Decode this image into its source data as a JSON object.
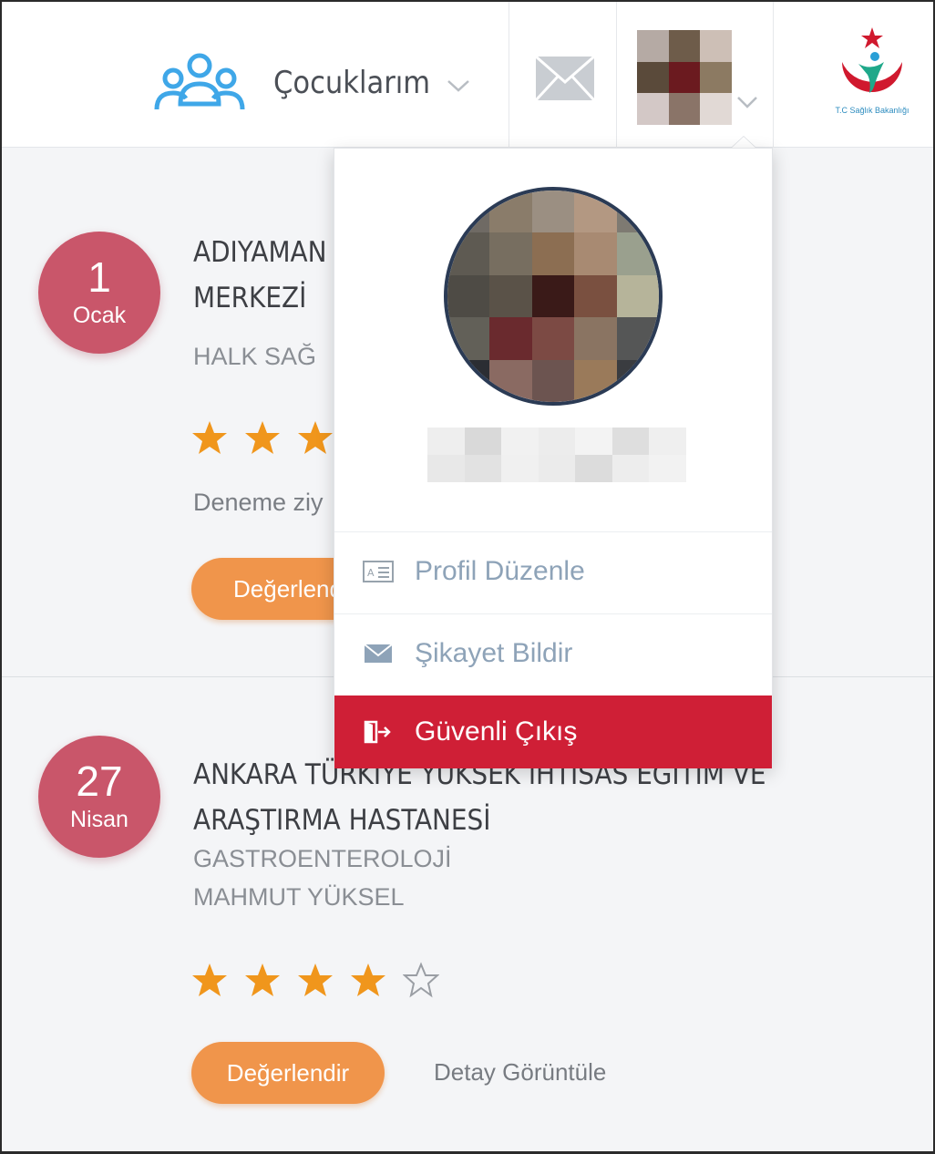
{
  "header": {
    "children_label": "Çocuklarım",
    "logo_caption": "T.C Sağlık Bakanlığı"
  },
  "appointments": [
    {
      "day": "1",
      "month": "Ocak",
      "institution_line1": "ADIYAMAN",
      "institution_line2": "MERKEZİ",
      "department": "HALK SAĞ",
      "rating": 3,
      "note": "Deneme ziy",
      "rate_label": "Değerlend"
    },
    {
      "day": "27",
      "month": "Nisan",
      "institution_line1": "ANKARA TÜRKİYE YÜKSEK İHTİSAS EĞİTİM VE",
      "institution_line2": "ARAŞTIRMA HASTANESİ",
      "department": "GASTROENTEROLOJİ",
      "doctor": "MAHMUT YÜKSEL",
      "rating": 4,
      "rating_max": 5,
      "rate_label": "Değerlendir",
      "detail_label": "Detay Görüntüle"
    }
  ],
  "profile_menu": {
    "items": [
      {
        "label": "Profil Düzenle",
        "icon": "id-card-icon"
      },
      {
        "label": "Şikayet Bildir",
        "icon": "envelope-icon"
      },
      {
        "label": "Güvenli Çıkış",
        "icon": "logout-icon"
      }
    ]
  },
  "colors": {
    "badge": "#c9566a",
    "button": "#f0954b",
    "star": "#f0961c",
    "logout": "#cf1f36",
    "menu_text": "#8ea3b8"
  }
}
